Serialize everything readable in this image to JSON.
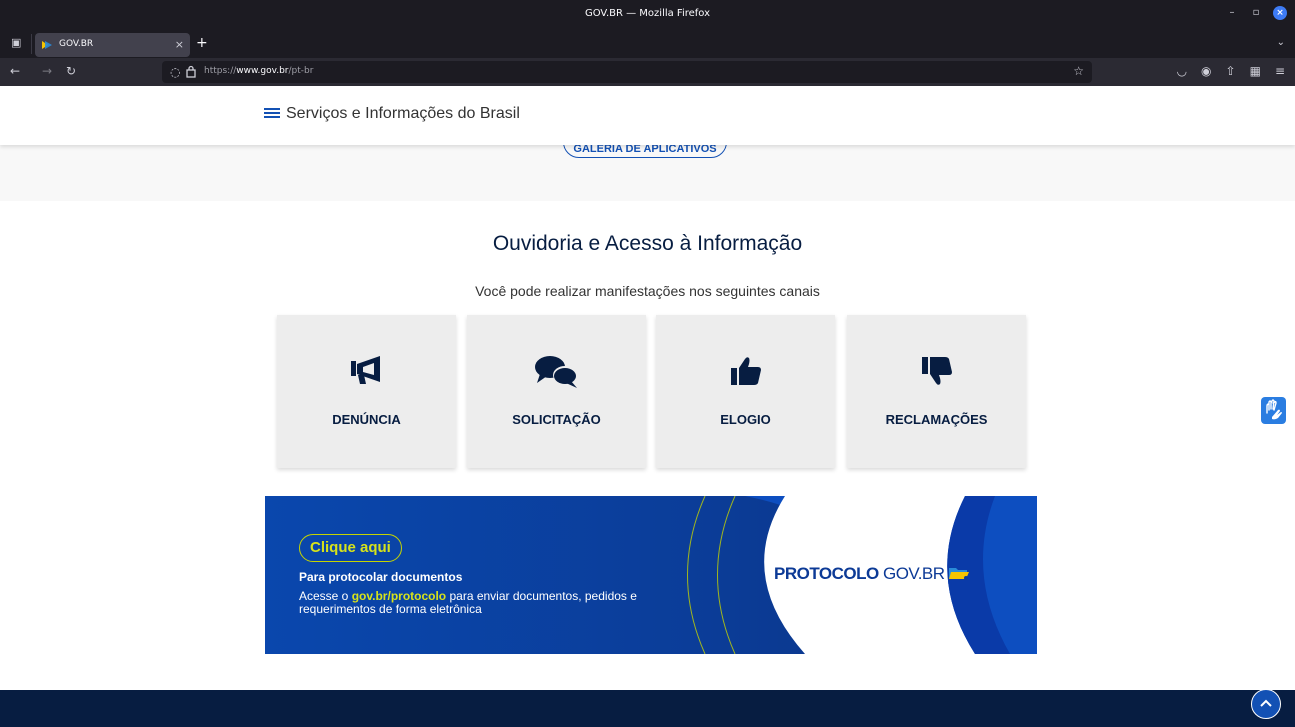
{
  "browser": {
    "window_title": "GOV.BR — Mozilla Firefox",
    "tab_title": "GOV.BR",
    "url_prefix": "https://",
    "url_host": "www.gov.br",
    "url_path": "/pt-br"
  },
  "header": {
    "title": "Serviços e Informações do Brasil"
  },
  "gallery": {
    "label": "GALERIA DE APLICATIVOS"
  },
  "ouvidoria": {
    "title": "Ouvidoria e Acesso à Informação",
    "subtitle": "Você pode realizar manifestações nos seguintes canais",
    "cards": [
      {
        "label": "DENÚNCIA",
        "icon": "megaphone-icon"
      },
      {
        "label": "SOLICITAÇÃO",
        "icon": "comments-icon"
      },
      {
        "label": "ELOGIO",
        "icon": "thumbs-up-icon"
      },
      {
        "label": "RECLAMAÇÕES",
        "icon": "thumbs-down-icon"
      }
    ]
  },
  "banner": {
    "cta": "Clique aqui",
    "heading": "Para protocolar documentos",
    "text_prefix": "Acesse o ",
    "link": "gov.br/protocolo",
    "text_suffix": " para enviar documentos, pedidos e requerimentos de forma eletrônica",
    "logo_bold": "PROTOCOLO",
    "logo_light": "GOV.BR"
  },
  "colors": {
    "primary_blue": "#1351b4",
    "dark_blue": "#071d41",
    "highlight_yellow": "#d7e31a"
  }
}
